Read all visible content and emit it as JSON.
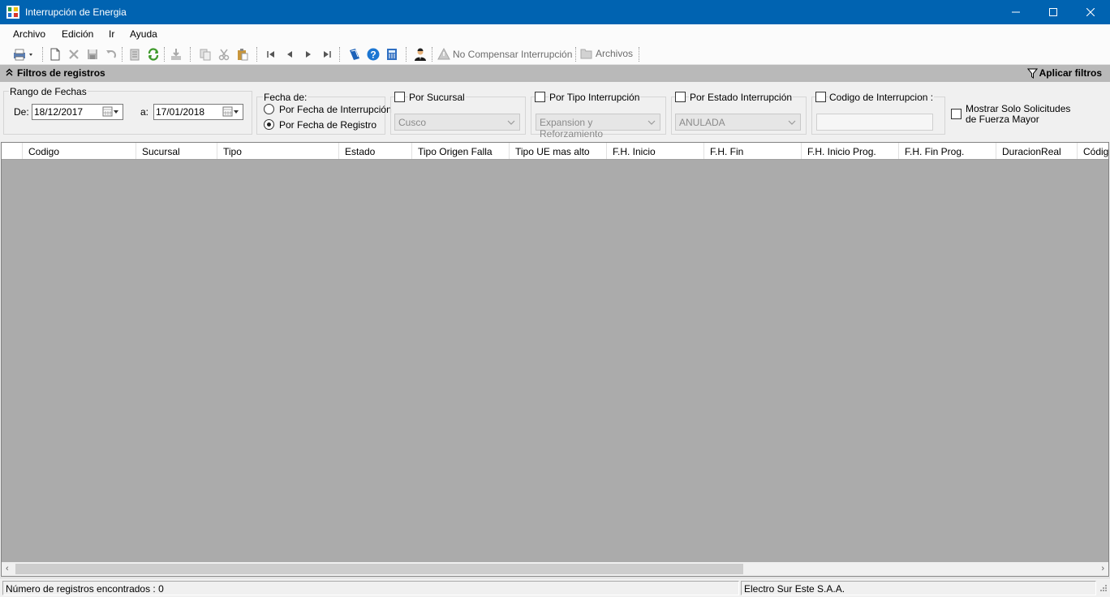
{
  "window": {
    "title": "Interrupción de Energia"
  },
  "menu": [
    "Archivo",
    "Edición",
    "Ir",
    "Ayuda"
  ],
  "toolbar": {
    "no_compensar": "No Compensar Interrupción",
    "archivos": "Archivos"
  },
  "filters": {
    "header": "Filtros de registros",
    "apply": "Aplicar filtros",
    "rango_fechas": "Rango de Fechas",
    "de_label": "De:",
    "de_value": "18/12/2017",
    "a_label": "a:",
    "a_value": "17/01/2018",
    "fecha_de": "Fecha de:",
    "opt_interrupcion": "Por Fecha de Interrupción",
    "opt_registro": "Por Fecha de Registro",
    "selected_option": "registro",
    "por_sucursal": "Por Sucursal",
    "sucursal_value": "Cusco",
    "por_tipo": "Por Tipo Interrupción",
    "tipo_value": "Expansion y Reforzamiento",
    "por_estado": "Por Estado Interrupción",
    "estado_value": "ANULADA",
    "codigo": "Codigo de Interrupcion :",
    "codigo_value": "",
    "mostrar_line1": "Mostrar Solo Solicitudes",
    "mostrar_line2": "de Fuerza Mayor"
  },
  "grid": {
    "columns": [
      "Codigo",
      "Sucursal",
      "Tipo",
      "Estado",
      "Tipo Origen Falla",
      "Tipo UE mas alto",
      "F.H. Inicio",
      "F.H. Fin",
      "F.H. Inicio Prog.",
      "F.H. Fin Prog.",
      "DuracionReal",
      "Código"
    ],
    "rows": []
  },
  "status": {
    "registros": "Número de registros encontrados : 0",
    "empresa": "Electro Sur Este S.A.A."
  },
  "colors": {
    "titlebar": "#0063b1",
    "grid_bg": "#ababab",
    "filter_header": "#b9b9b9"
  }
}
